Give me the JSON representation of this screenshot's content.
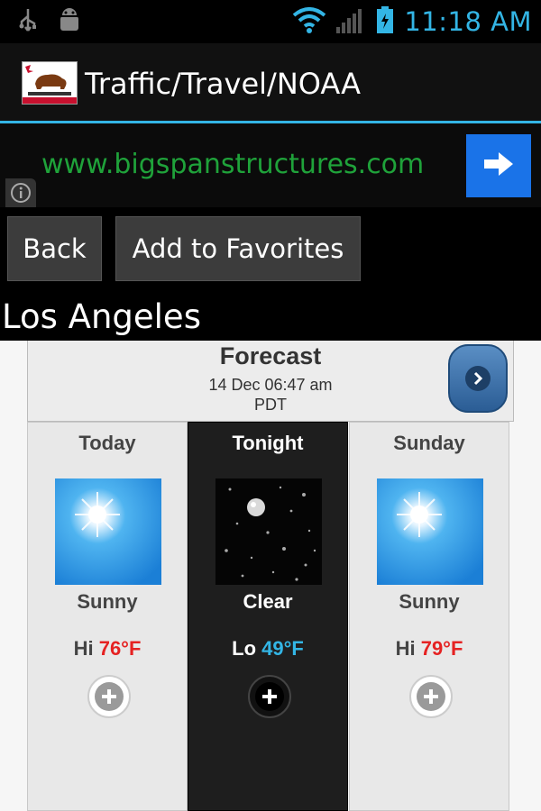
{
  "status_bar": {
    "time": "11:18 AM",
    "icons": [
      "usb-icon",
      "android-debug-icon",
      "wifi-icon",
      "signal-icon",
      "battery-icon"
    ],
    "accent": "#33b5e5"
  },
  "app": {
    "title": "Traffic/Travel/NOAA",
    "logo": "california-flag-logo"
  },
  "ad": {
    "text": "www.bigspanstructures.com",
    "arrow_icon": "arrow-right-icon",
    "info_icon": "info-icon"
  },
  "buttons": {
    "back": "Back",
    "favorites": "Add to Favorites"
  },
  "city": "Los Angeles",
  "forecast": {
    "title": "Forecast",
    "date_line1": "14 Dec 06:47 am",
    "date_line2": "PDT",
    "periods": [
      {
        "name": "Today",
        "icon": "sunny-icon",
        "condition": "Sunny",
        "temp_label": "Hi",
        "temp": "76°F",
        "temp_color": "#e52222"
      },
      {
        "name": "Tonight",
        "icon": "clear-night-icon",
        "condition": "Clear",
        "temp_label": "Lo",
        "temp": "49°F",
        "temp_color": "#33b5e5"
      },
      {
        "name": "Sunday",
        "icon": "sunny-icon",
        "condition": "Sunny",
        "temp_label": "Hi",
        "temp": "79°F",
        "temp_color": "#e52222"
      }
    ]
  }
}
